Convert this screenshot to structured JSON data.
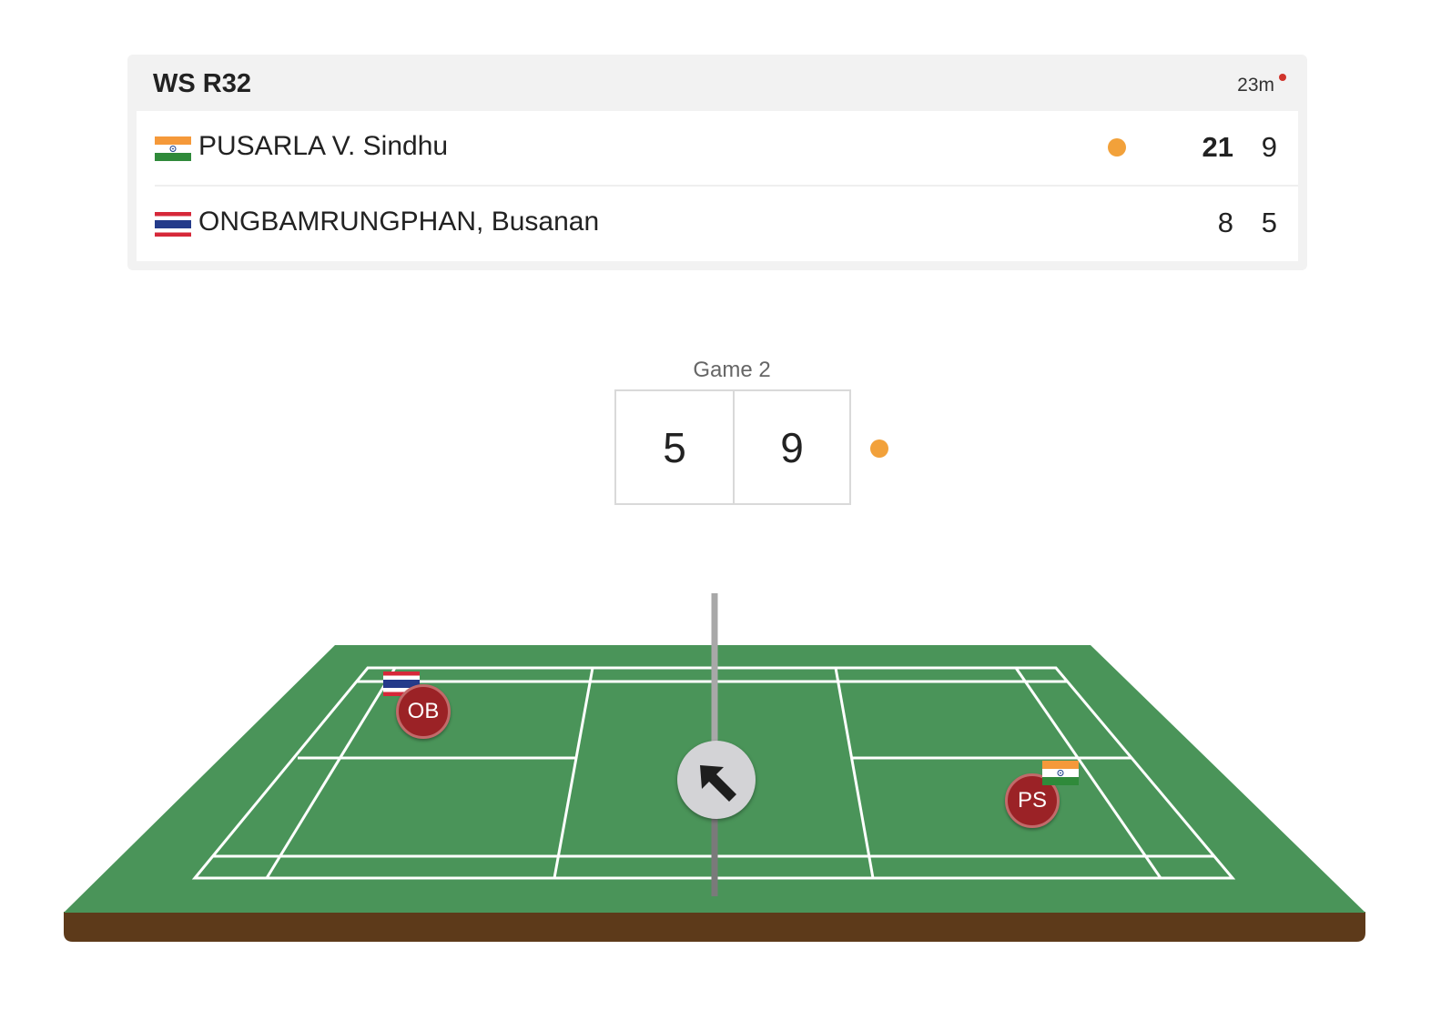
{
  "match": {
    "event": "WS R32",
    "duration": "23m"
  },
  "players": [
    {
      "name": "PUSARLA V. Sindhu",
      "country_flag": "india-flag",
      "serving": true,
      "games": [
        "21",
        "9"
      ],
      "initials": "PS"
    },
    {
      "name": "ONGBAMRUNGPHAN, Busanan",
      "country_flag": "thailand-flag",
      "serving": false,
      "games": [
        "8",
        "5"
      ],
      "initials": "OB"
    }
  ],
  "current_game": {
    "label": "Game 2",
    "left_score": "5",
    "right_score": "9",
    "serving_side": "right"
  },
  "colors": {
    "serve_dot": "#f2a13a",
    "live_dot": "#d0342c",
    "court_green": "#4a9459",
    "court_base": "#5d3a1a",
    "player_marker": "#9b2226"
  },
  "court": {
    "shuttle_direction_icon": "arrow-up-left-icon"
  }
}
